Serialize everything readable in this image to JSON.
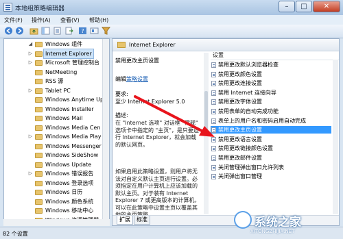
{
  "window": {
    "title": "本地组策略编辑器"
  },
  "menu": [
    "文件(F)",
    "操作(A)",
    "查看(V)",
    "帮助(H)"
  ],
  "toolbar_icons": [
    "back-icon",
    "forward-icon",
    "up-folder-icon",
    "show-hide-tree-icon",
    "properties-icon",
    "export-icon",
    "help-icon",
    "view-icon",
    "filter-icon"
  ],
  "tree": {
    "items": [
      {
        "label": "Windows 组件",
        "expander": "◢",
        "selected": false
      },
      {
        "label": "Internet Explorer",
        "expander": "▷",
        "selected": true
      },
      {
        "label": "Microsoft 管理控制台",
        "expander": "▷",
        "selected": false
      },
      {
        "label": "NetMeeting",
        "expander": "",
        "selected": false
      },
      {
        "label": "RSS 源",
        "expander": "",
        "selected": false
      },
      {
        "label": "Tablet PC",
        "expander": "▷",
        "selected": false
      },
      {
        "label": "Windows Anytime Up",
        "expander": "",
        "selected": false
      },
      {
        "label": "Windows Installer",
        "expander": "",
        "selected": false
      },
      {
        "label": "Windows Mail",
        "expander": "",
        "selected": false
      },
      {
        "label": "Windows Media Cen",
        "expander": "",
        "selected": false
      },
      {
        "label": "Windows Media Play",
        "expander": "▷",
        "selected": false
      },
      {
        "label": "Windows Messenger",
        "expander": "",
        "selected": false
      },
      {
        "label": "Windows SideShow",
        "expander": "",
        "selected": false
      },
      {
        "label": "Windows Update",
        "expander": "",
        "selected": false
      },
      {
        "label": "Windows 错误报告",
        "expander": "▷",
        "selected": false
      },
      {
        "label": "Windows 登录选项",
        "expander": "",
        "selected": false
      },
      {
        "label": "Windows 日历",
        "expander": "",
        "selected": false
      },
      {
        "label": "Windows 颜色系统",
        "expander": "",
        "selected": false
      },
      {
        "label": "Windows 移动中心",
        "expander": "",
        "selected": false
      },
      {
        "label": "Windows 资源管理器",
        "expander": "",
        "selected": false
      }
    ]
  },
  "pane": {
    "header_title": "Internet Explorer",
    "setting_title": "禁用更改主页设置",
    "edit_prefix": "编辑",
    "edit_link": "策略设置",
    "requirements_label": "要求:",
    "requirements_value": "至少 Internet Explorer 5.0",
    "description_label": "描述:",
    "description_text": "在 \"Internet 选项\" 对话框 \"常规\" 选项卡中指定的 \"主页\"，是只要运行 Internet Explorer，就会加载的默认网页。",
    "description_text2": "如果启用此策略设置，则用户将无法对自定义默认主页进行设置。必须指定在用户计算机上应该加载的默认主页。对于装有 Internet Explorer 7 或更高版本的计算机，可以在此策略中设置主页以覆盖其他的主页策略。"
  },
  "settings": {
    "column_header": "设置",
    "items": [
      {
        "label": "禁用更改默认浏览器检查",
        "selected": false
      },
      {
        "label": "禁用更改颜色设置",
        "selected": false
      },
      {
        "label": "禁用更改连接设置",
        "selected": false
      },
      {
        "label": "禁用 Internet 连接向导",
        "selected": false
      },
      {
        "label": "禁用更改字体设置",
        "selected": false
      },
      {
        "label": "禁用表单的自动完成功能",
        "selected": false
      },
      {
        "label": "表单上的用户名和密码启用自动完成",
        "selected": false
      },
      {
        "label": "禁用更改主页设置",
        "selected": true
      },
      {
        "label": "禁用更改语言设置",
        "selected": false
      },
      {
        "label": "禁用更改链接颜色设置",
        "selected": false
      },
      {
        "label": "禁用更改邮件设置",
        "selected": false
      },
      {
        "label": "关闭管理弹出窗口允许列表",
        "selected": false
      },
      {
        "label": "关闭弹出窗口管理",
        "selected": false
      }
    ]
  },
  "tabs": [
    "扩展",
    "标准"
  ],
  "status": {
    "text": "82 个设置"
  },
  "watermark": {
    "text": "系统之家",
    "url": "XITONGZHIJIA.NET"
  },
  "colors": {
    "selection": "#3399ff",
    "arrow": "#e8141c",
    "link": "#1a5fb4"
  }
}
